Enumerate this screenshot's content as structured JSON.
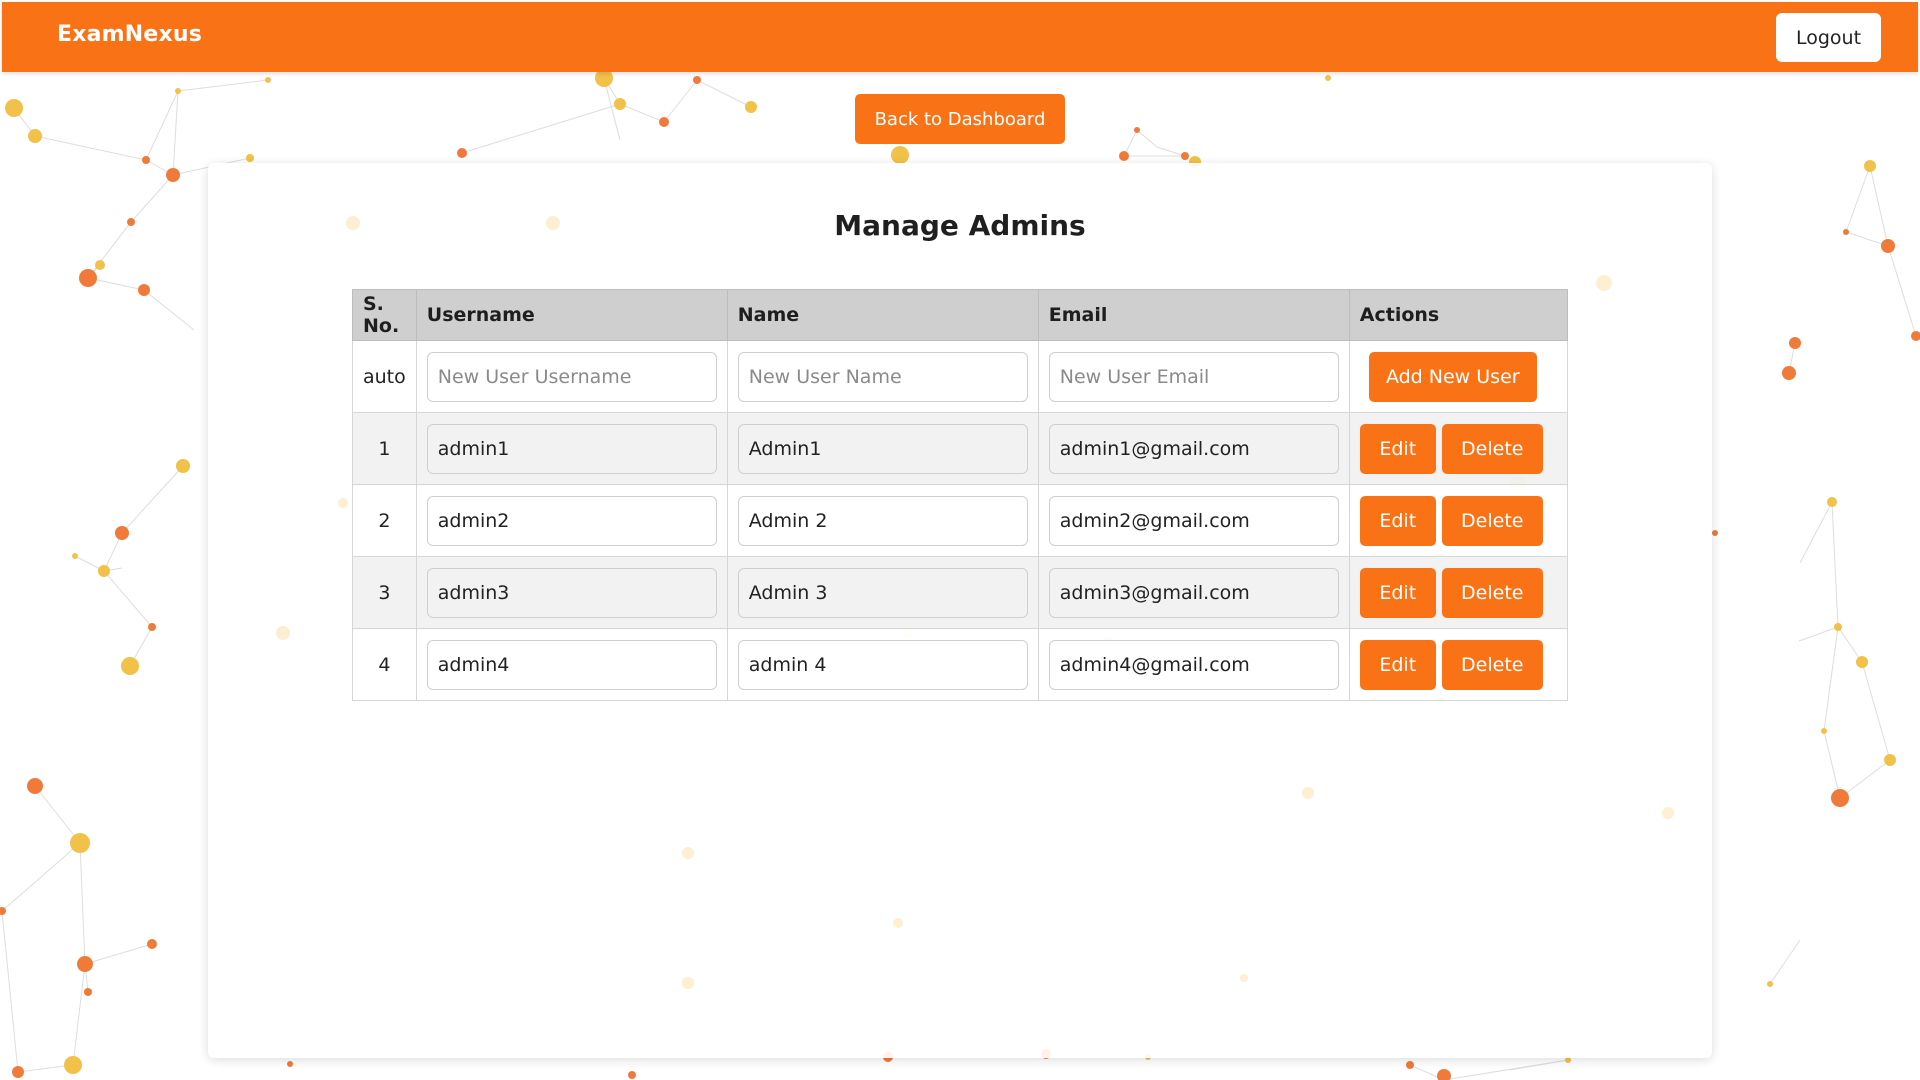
{
  "colors": {
    "accent": "#f97316",
    "header_bg": "#cfcfcf",
    "dot_orange": "#f07a3a",
    "dot_yellow": "#f2c14a"
  },
  "navbar": {
    "brand": "ExamNexus",
    "logout_label": "Logout"
  },
  "back_button_label": "Back to Dashboard",
  "page_title": "Manage Admins",
  "table": {
    "columns": [
      "S. No.",
      "Username",
      "Name",
      "Email",
      "Actions"
    ],
    "new_row": {
      "sno": "auto",
      "username_placeholder": "New User Username",
      "name_placeholder": "New User Name",
      "email_placeholder": "New User Email",
      "add_label": "Add New User"
    },
    "rows": [
      {
        "sno": "1",
        "username": "admin1",
        "name": "Admin1",
        "email": "admin1@gmail.com"
      },
      {
        "sno": "2",
        "username": "admin2",
        "name": "Admin 2",
        "email": "admin2@gmail.com"
      },
      {
        "sno": "3",
        "username": "admin3",
        "name": "Admin 3",
        "email": "admin3@gmail.com"
      },
      {
        "sno": "4",
        "username": "admin4",
        "name": "admin 4",
        "email": "admin4@gmail.com"
      }
    ],
    "edit_label": "Edit",
    "delete_label": "Delete"
  },
  "background": {
    "pattern": "network-particles"
  }
}
